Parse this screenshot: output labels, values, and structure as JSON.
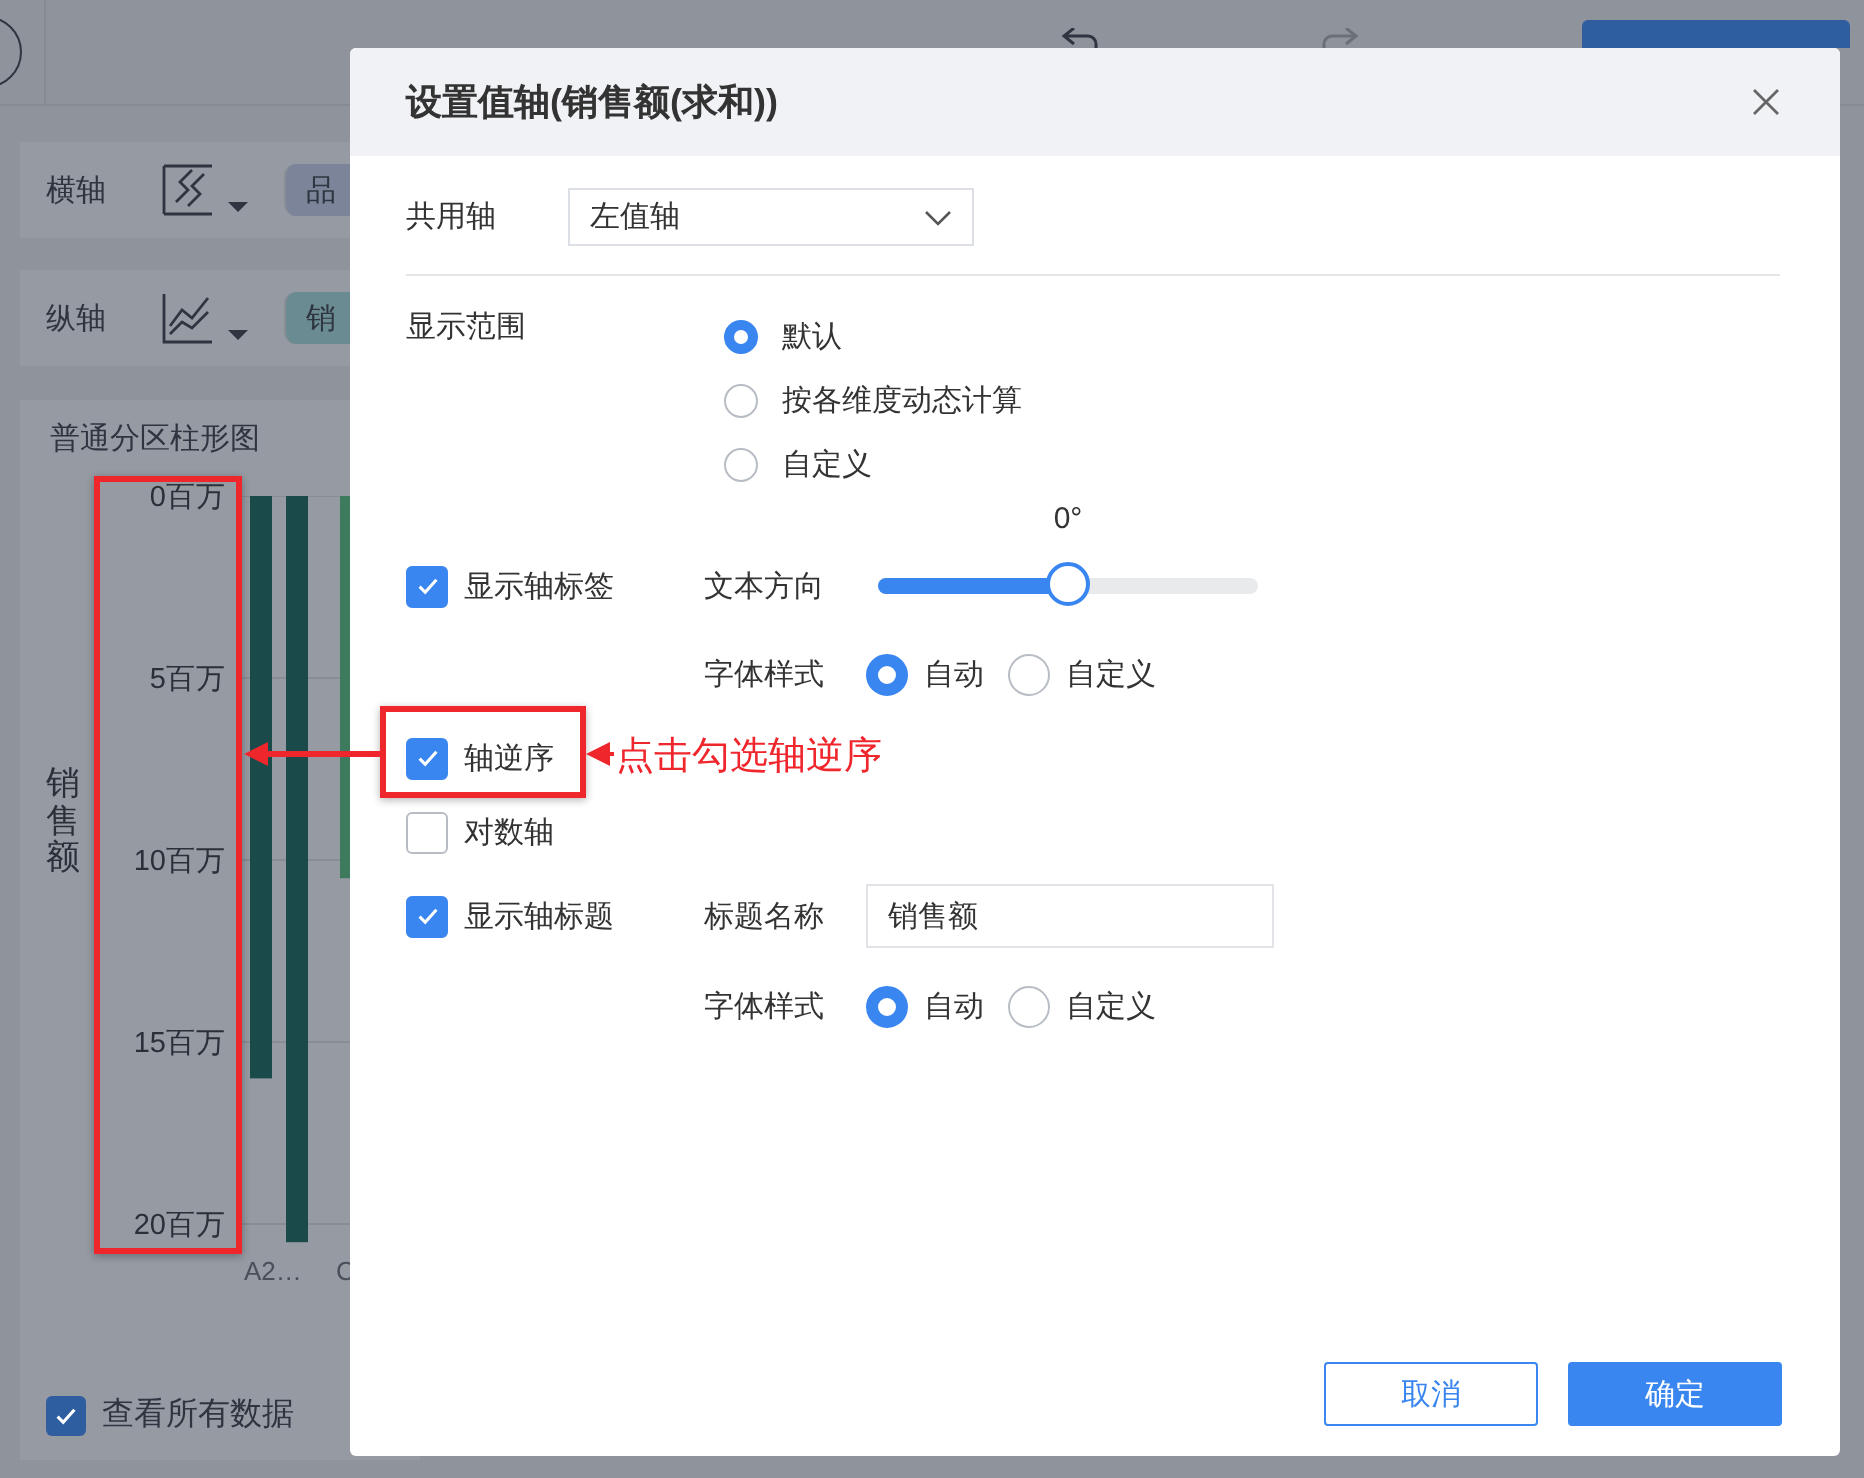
{
  "background": {
    "x_axis": {
      "label": "横轴",
      "field": "品"
    },
    "y_axis": {
      "label": "纵轴",
      "field": "销"
    },
    "chart": {
      "title": "普通分区柱形图",
      "axis_title": "销售额",
      "chart_data": {
        "type": "bar",
        "categories": [
          "A2…",
          "C"
        ],
        "series": [
          {
            "color": "#1b4a4b",
            "values": [
              16,
              null
            ]
          },
          {
            "color": "#1b4a4b",
            "values": [
              20.5,
              null
            ]
          },
          {
            "color": "#3d7a5e",
            "values": [
              null,
              10.5
            ]
          }
        ],
        "ylim": [
          20.8,
          0
        ],
        "grid": true,
        "yticks": [
          {
            "value": 0,
            "label": "0百万"
          },
          {
            "value": 5,
            "label": "5百万"
          },
          {
            "value": 10,
            "label": "10百万"
          },
          {
            "value": 15,
            "label": "15百万"
          },
          {
            "value": 20,
            "label": "20百万"
          }
        ]
      }
    },
    "view_all": {
      "label": "查看所有数据",
      "checked": true
    }
  },
  "dialog": {
    "title": "设置值轴(销售额(求和))",
    "shared_axis": {
      "label": "共用轴",
      "value": "左值轴"
    },
    "display_range": {
      "label": "显示范围",
      "options": [
        {
          "label": "默认",
          "selected": true
        },
        {
          "label": "按各维度动态计算",
          "selected": false
        },
        {
          "label": "自定义",
          "selected": false
        }
      ]
    },
    "show_axis_labels": {
      "label": "显示轴标签",
      "checked": true,
      "text_direction": {
        "label": "文本方向",
        "reading": "0°",
        "level": 0.5
      },
      "font_style": {
        "label": "字体样式",
        "options": [
          {
            "label": "自动",
            "selected": true
          },
          {
            "label": "自定义",
            "selected": false
          }
        ]
      }
    },
    "reverse_axis": {
      "label": "轴逆序",
      "checked": true
    },
    "log_axis": {
      "label": "对数轴",
      "checked": false
    },
    "show_axis_title": {
      "label": "显示轴标题",
      "checked": true,
      "title_name": {
        "label": "标题名称",
        "value": "销售额"
      },
      "font_style": {
        "label": "字体样式",
        "options": [
          {
            "label": "自动",
            "selected": true
          },
          {
            "label": "自定义",
            "selected": false
          }
        ]
      }
    },
    "buttons": [
      {
        "label": "取消",
        "kind": "secondary"
      },
      {
        "label": "确定",
        "kind": "primary"
      }
    ]
  },
  "annotation": {
    "text": "点击勾选轴逆序"
  }
}
